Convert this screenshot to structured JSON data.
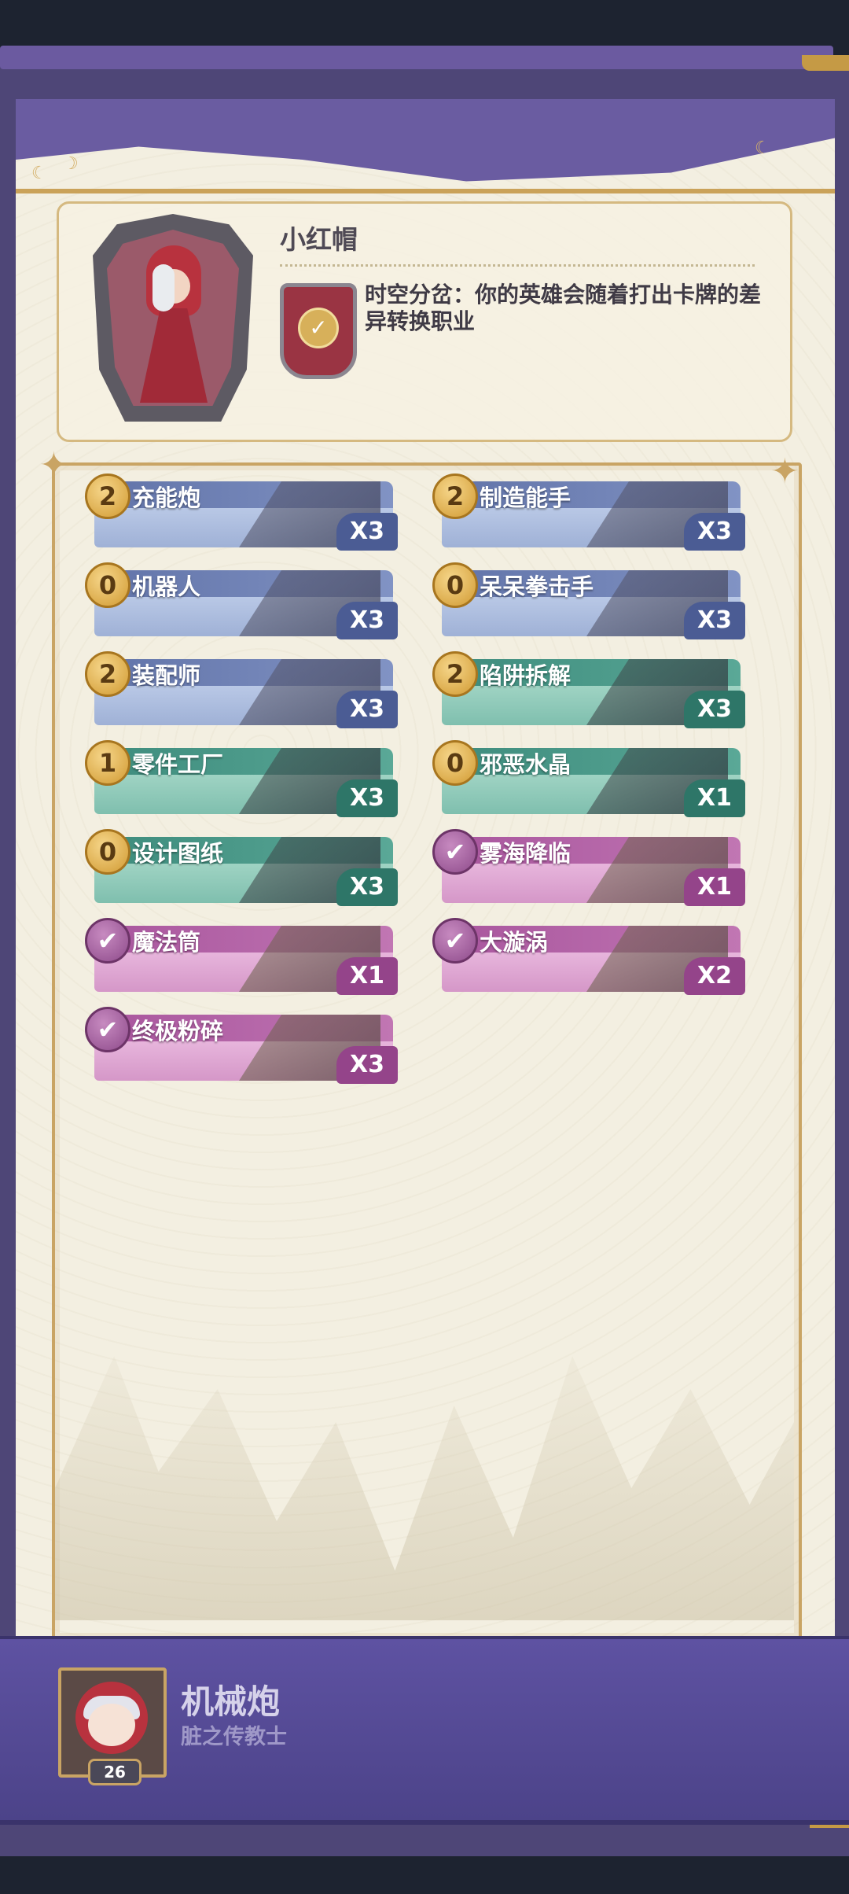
{
  "hero": {
    "name": "小红帽",
    "skill_text": "时空分岔：你的英雄会随着打出卡牌的差异转换职业"
  },
  "cards": [
    {
      "cost": "2",
      "name": "充能炮",
      "qty": "X3",
      "style": "blue"
    },
    {
      "cost": "2",
      "name": "制造能手",
      "qty": "X3",
      "style": "blue"
    },
    {
      "cost": "0",
      "name": "机器人",
      "qty": "X3",
      "style": "blue"
    },
    {
      "cost": "0",
      "name": "呆呆拳击手",
      "qty": "X3",
      "style": "blue"
    },
    {
      "cost": "2",
      "name": "装配师",
      "qty": "X3",
      "style": "blue"
    },
    {
      "cost": "2",
      "name": "陷阱拆解",
      "qty": "X3",
      "style": "teal"
    },
    {
      "cost": "1",
      "name": "零件工厂",
      "qty": "X3",
      "style": "teal"
    },
    {
      "cost": "0",
      "name": "邪恶水晶",
      "qty": "X1",
      "style": "teal"
    },
    {
      "cost": "0",
      "name": "设计图纸",
      "qty": "X3",
      "style": "teal"
    },
    {
      "cost": "✔",
      "name": "雾海降临",
      "qty": "X1",
      "style": "pink"
    },
    {
      "cost": "✔",
      "name": "魔法筒",
      "qty": "X1",
      "style": "pink"
    },
    {
      "cost": "✔",
      "name": "大漩涡",
      "qty": "X2",
      "style": "pink"
    },
    {
      "cost": "✔",
      "name": "终极粉碎",
      "qty": "X3",
      "style": "pink"
    }
  ],
  "deck": {
    "name": "机械炮",
    "subtitle": "脏之传教士",
    "level": "26"
  },
  "colors": {
    "frame_purple": "#6a5ca1",
    "paper": "#f3efe1",
    "gold": "#c9a464",
    "blue_card": "#6173a8",
    "teal_card": "#3d8b7c",
    "pink_card": "#a8559d"
  }
}
